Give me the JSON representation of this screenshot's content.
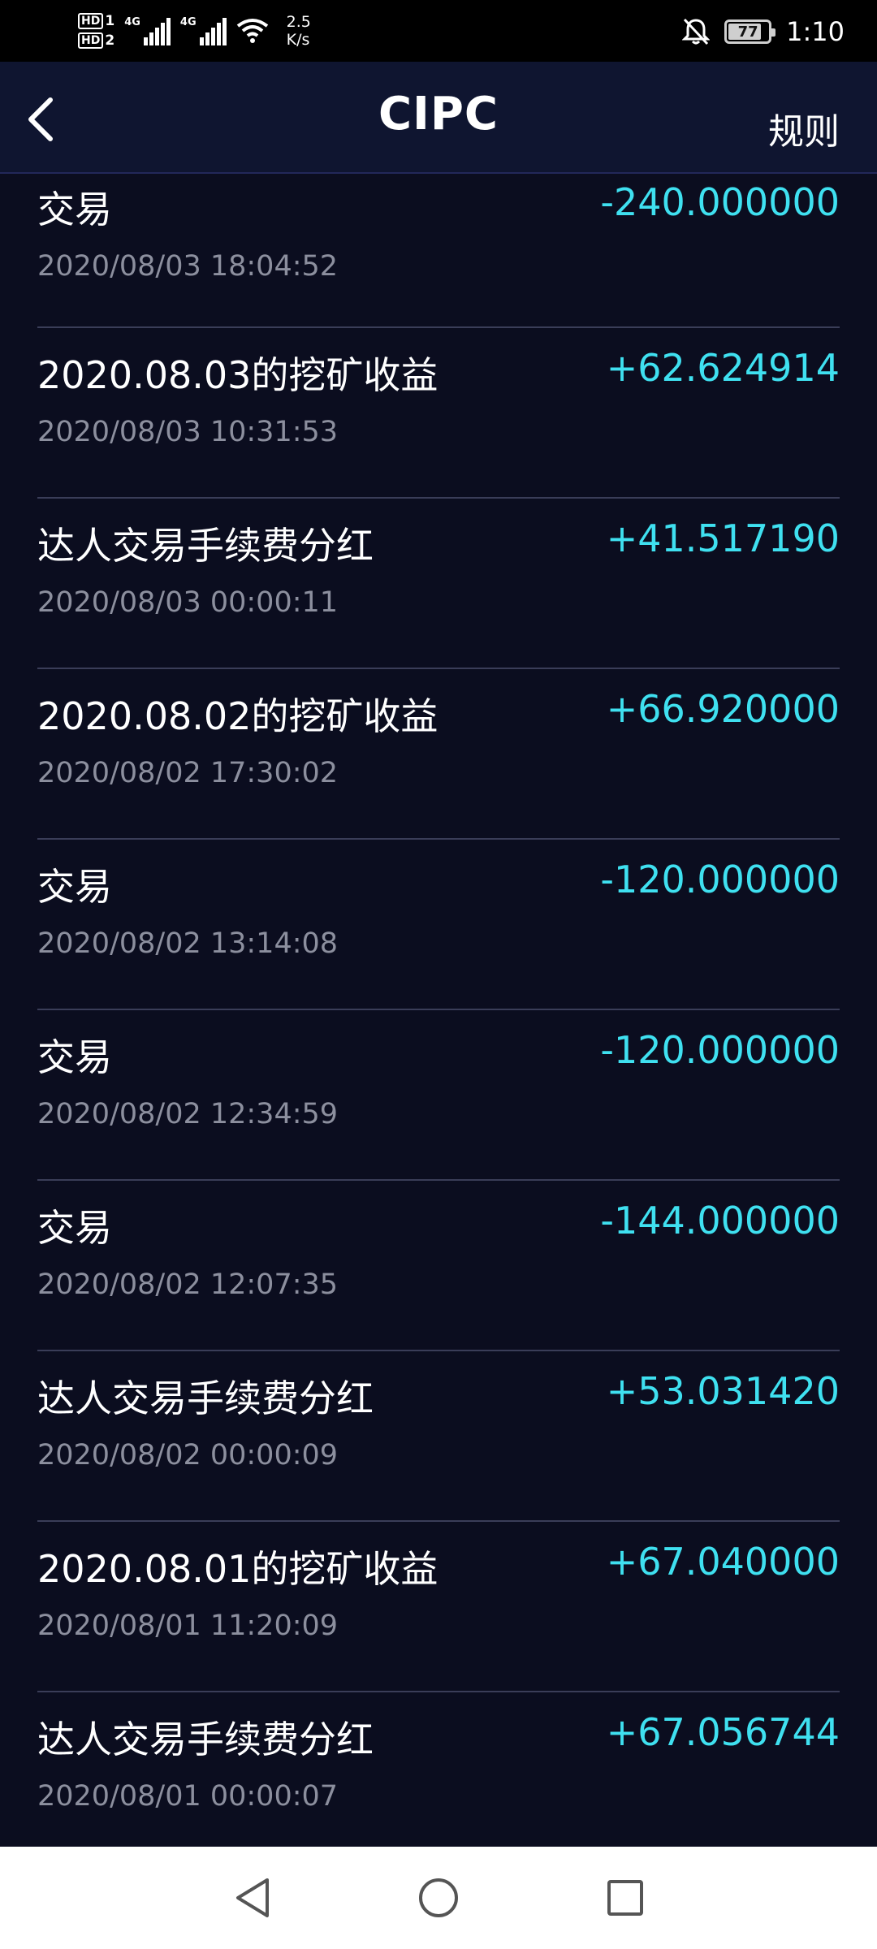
{
  "status_bar": {
    "hd1": "HD",
    "hd1_sub": "1",
    "hd2": "HD",
    "hd2_sub": "2",
    "signal1_label": "4G",
    "signal2_label": "4G",
    "net_speed_value": "2.5",
    "net_speed_unit": "K/s",
    "battery": "77",
    "time": "1:10"
  },
  "header": {
    "title": "CIPC",
    "rules_label": "规则"
  },
  "transactions": [
    {
      "title": "交易",
      "amount": "-240.000000",
      "time": "2020/08/03 18:04:52"
    },
    {
      "title": "2020.08.03的挖矿收益",
      "amount": "+62.624914",
      "time": "2020/08/03 10:31:53"
    },
    {
      "title": "达人交易手续费分红",
      "amount": "+41.517190",
      "time": "2020/08/03 00:00:11"
    },
    {
      "title": "2020.08.02的挖矿收益",
      "amount": "+66.920000",
      "time": "2020/08/02 17:30:02"
    },
    {
      "title": "交易",
      "amount": "-120.000000",
      "time": "2020/08/02 13:14:08"
    },
    {
      "title": "交易",
      "amount": "-120.000000",
      "time": "2020/08/02 12:34:59"
    },
    {
      "title": "交易",
      "amount": "-144.000000",
      "time": "2020/08/02 12:07:35"
    },
    {
      "title": "达人交易手续费分红",
      "amount": "+53.031420",
      "time": "2020/08/02 00:00:09"
    },
    {
      "title": "2020.08.01的挖矿收益",
      "amount": "+67.040000",
      "time": "2020/08/01 11:20:09"
    },
    {
      "title": "达人交易手续费分红",
      "amount": "+67.056744",
      "time": "2020/08/01 00:00:07"
    }
  ],
  "colors": {
    "background": "#0b0d1f",
    "header": "#0f1530",
    "amount": "#3fe0f0",
    "time": "#8c8f9e",
    "divider": "#3a3d58"
  },
  "icons": {
    "back": "chevron-left-icon",
    "nav_back": "triangle-back-icon",
    "nav_home": "circle-home-icon",
    "nav_recent": "square-recent-icon"
  }
}
